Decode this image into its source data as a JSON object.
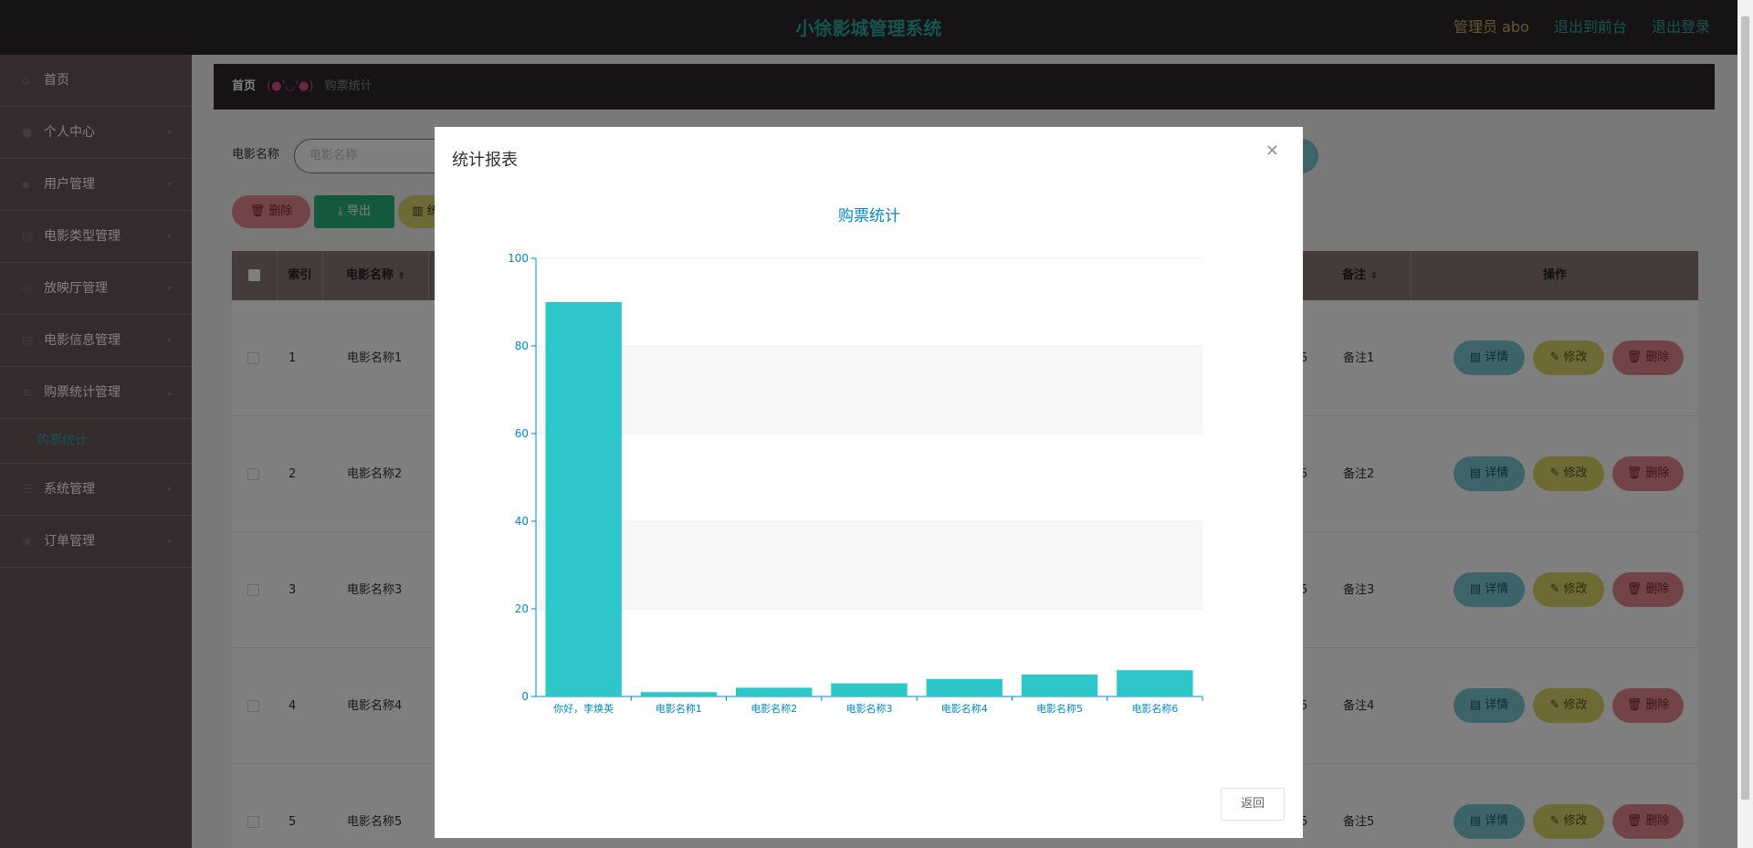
{
  "header": {
    "title": "小徐影城管理系统",
    "admin": "管理员 abo",
    "to_front": "退出到前台",
    "logout": "退出登录"
  },
  "sidebar": {
    "items": [
      {
        "label": "首页",
        "icon": "home-icon"
      },
      {
        "label": "个人中心",
        "icon": "user-icon"
      },
      {
        "label": "用户管理",
        "icon": "users-icon"
      },
      {
        "label": "电影类型管理",
        "icon": "list-icon"
      },
      {
        "label": "放映厅管理",
        "icon": "hall-icon"
      },
      {
        "label": "电影信息管理",
        "icon": "film-icon"
      },
      {
        "label": "购票统计管理",
        "icon": "stat-icon"
      }
    ],
    "submenu": "购票统计",
    "bottom_items": [
      {
        "label": "系统管理",
        "icon": "settings-icon"
      },
      {
        "label": "订单管理",
        "icon": "order-icon"
      }
    ]
  },
  "breadcrumb": {
    "home": "首页",
    "separator": "(●'◡'●)",
    "current": "购票统计"
  },
  "search": {
    "label": "电影名称",
    "placeholder": "电影名称"
  },
  "toolbar": {
    "delete": "删除",
    "export": "导出",
    "stats": "统"
  },
  "table": {
    "headers": {
      "index": "索引",
      "name": "电影名称",
      "remark": "备注",
      "ops": "操作"
    },
    "rows": [
      {
        "index": "1",
        "name": "电影名称1",
        "partial": "5",
        "remark": "备注1"
      },
      {
        "index": "2",
        "name": "电影名称2",
        "partial": "5",
        "remark": "备注2"
      },
      {
        "index": "3",
        "name": "电影名称3",
        "partial": "5",
        "remark": "备注3"
      },
      {
        "index": "4",
        "name": "电影名称4",
        "partial": "5",
        "remark": "备注4"
      },
      {
        "index": "5",
        "name": "电影名称5",
        "partial": "5",
        "remark": "备注5"
      }
    ],
    "btn_detail": "详情",
    "btn_edit": "修改",
    "btn_delete": "删除"
  },
  "modal": {
    "title": "统计报表",
    "back": "返回"
  },
  "chart_data": {
    "type": "bar",
    "title": "购票统计",
    "categories": [
      "你好，李焕英",
      "电影名称1",
      "电影名称2",
      "电影名称3",
      "电影名称4",
      "电影名称5",
      "电影名称6"
    ],
    "values": [
      90,
      1,
      2,
      3,
      4,
      5,
      6
    ],
    "ylim": [
      0,
      100
    ],
    "yticks": [
      0,
      20,
      40,
      60,
      80,
      100
    ],
    "grid": true,
    "bar_color": "#2ec7c9",
    "axis_color": "#008acd"
  }
}
